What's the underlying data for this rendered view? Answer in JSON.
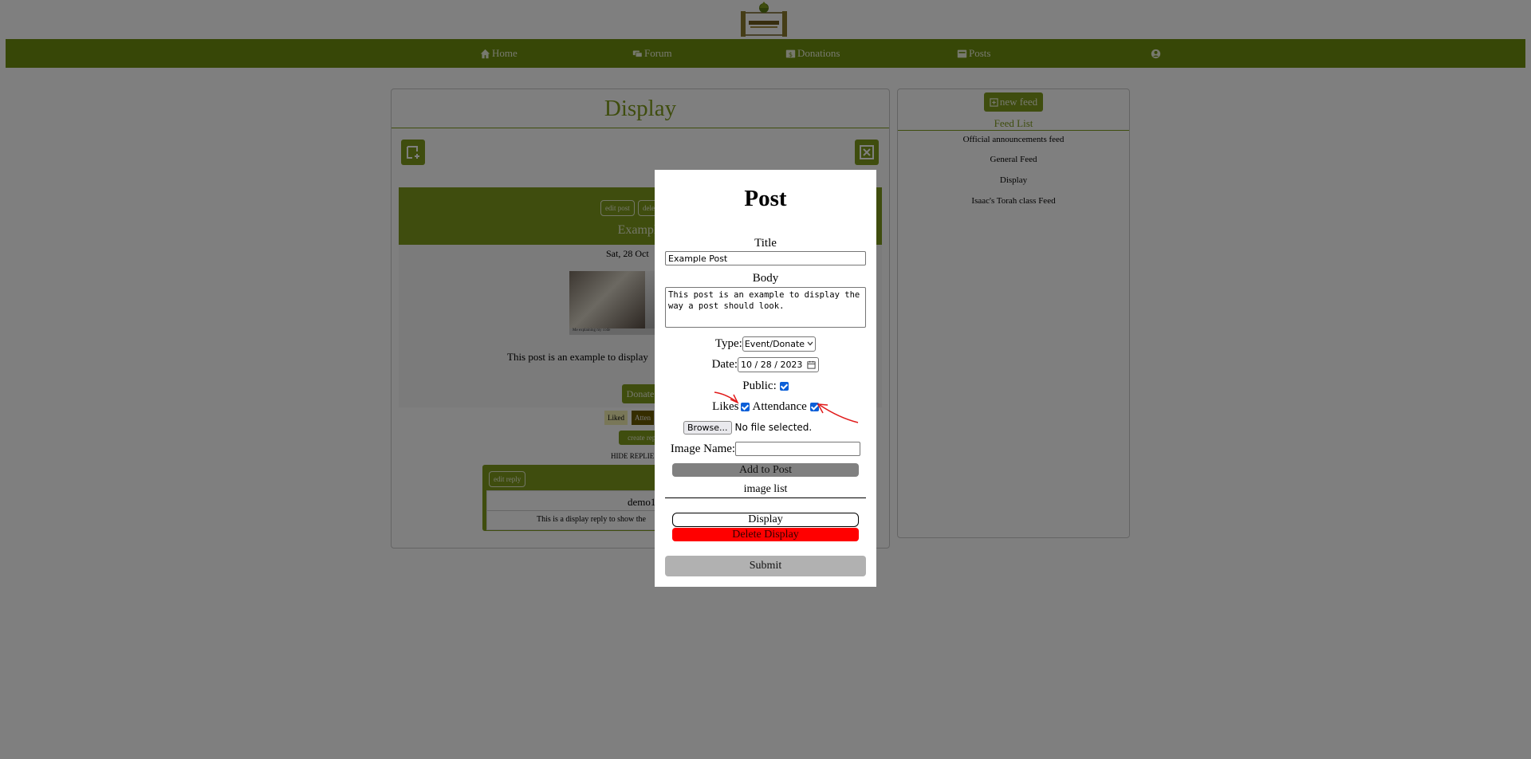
{
  "nav": {
    "logo_icon": "westwood-logo",
    "items": [
      {
        "label": "Home",
        "icon": "home-icon"
      },
      {
        "label": "Forum",
        "icon": "forum-icon"
      },
      {
        "label": "Donations",
        "icon": "donations-icon"
      },
      {
        "label": "Posts",
        "icon": "posts-icon"
      }
    ],
    "profile_icon": "user-circle-icon",
    "color": "#6f8f0f"
  },
  "display_panel": {
    "title": "Display",
    "add_post_icon": "add-post-icon",
    "close_feed_icon": "close-feed-icon",
    "post": {
      "edit_label": "edit post",
      "delete_label": "dele",
      "title": "Example",
      "date": "Sat, 28 Oct",
      "image_caption": "Me explaining my code",
      "body": "This post is an example to display",
      "donate_label": "Donate",
      "liked_label": "Liked",
      "attend_label": "Atten",
      "create_reply_label": "create repl",
      "hide_replies_label": "HIDE REPLIE",
      "reply": {
        "edit_label": "edit reply",
        "author": "demo1",
        "text": "This is a display reply to show the"
      }
    }
  },
  "feed_panel": {
    "new_feed_label": "new feed",
    "new_feed_icon": "plus-square-icon",
    "heading": "Feed List",
    "feeds": [
      "Official announcements feed",
      "General Feed",
      "Display",
      "Isaac's Torah class Feed"
    ]
  },
  "modal": {
    "title": "Post",
    "title_label": "Title",
    "title_value": "Example Post",
    "body_label": "Body",
    "body_value": "This post is an example to display the way a post should look.",
    "type_label": "Type:",
    "type_value": "Event/Donate",
    "date_label": "Date:",
    "date_value": "10 / 28 / 2023",
    "public_label": "Public:",
    "public_checked": true,
    "likes_label": "Likes",
    "likes_checked": true,
    "attendance_label": "Attendance",
    "attendance_checked": true,
    "browse_label": "Browse...",
    "file_status": "No file selected.",
    "image_name_label": "Image Name:",
    "image_name_value": "",
    "add_to_post_label": "Add to Post",
    "image_list_label": "image list",
    "image_items": [
      {
        "name": "Display",
        "delete_label": "Delete Display"
      }
    ],
    "submit_label": "Submit"
  },
  "colors": {
    "accent": "#7f9a1c",
    "delete": "#ff0000",
    "annotation": "#e11a1a"
  }
}
